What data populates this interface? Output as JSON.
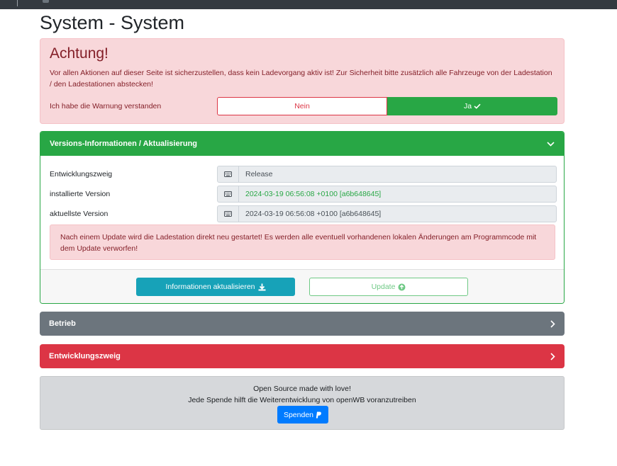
{
  "page": {
    "title": "System - System"
  },
  "warning": {
    "heading": "Achtung!",
    "message": "Vor allen Aktionen auf dieser Seite ist sicherzustellen, dass kein Ladevorgang aktiv ist! Zur Sicherheit bitte zusätzlich alle Fahrzeuge von der Ladestation / den Ladestationen abstecken!",
    "ack_label": "Ich habe die Warnung verstanden",
    "no_label": "Nein",
    "yes_label": "Ja",
    "selected": "Ja"
  },
  "versions": {
    "header": "Versions-Informationen / Aktualisierung",
    "rows": [
      {
        "label": "Entwicklungszweig",
        "value": "Release"
      },
      {
        "label": "installierte Version",
        "value": "2024-03-19 06:56:08 +0100 [a6b648645]"
      },
      {
        "label": "aktuellste Version",
        "value": "2024-03-19 06:56:08 +0100 [a6b648645]"
      }
    ],
    "notice": "Nach einem Update wird die Ladestation direkt neu gestartet! Es werden alle eventuell vorhandenen lokalen Änderungen am Programmcode mit dem Update verworfen!",
    "refresh_label": "Informationen aktualisieren",
    "update_label": "Update"
  },
  "sections": {
    "betrieb": "Betrieb",
    "entwicklungszweig": "Entwicklungszweig"
  },
  "donate": {
    "line1": "Open Source made with love!",
    "line2": "Jede Spende hilft die Weiterentwicklung von openWB voranzutreiben",
    "button_label": "Spenden"
  },
  "colors": {
    "success": "#28a745",
    "danger": "#dc3545",
    "secondary": "#6c757d",
    "info": "#17a2b8",
    "primary": "#007bff",
    "alert_bg": "#f8d7da"
  }
}
